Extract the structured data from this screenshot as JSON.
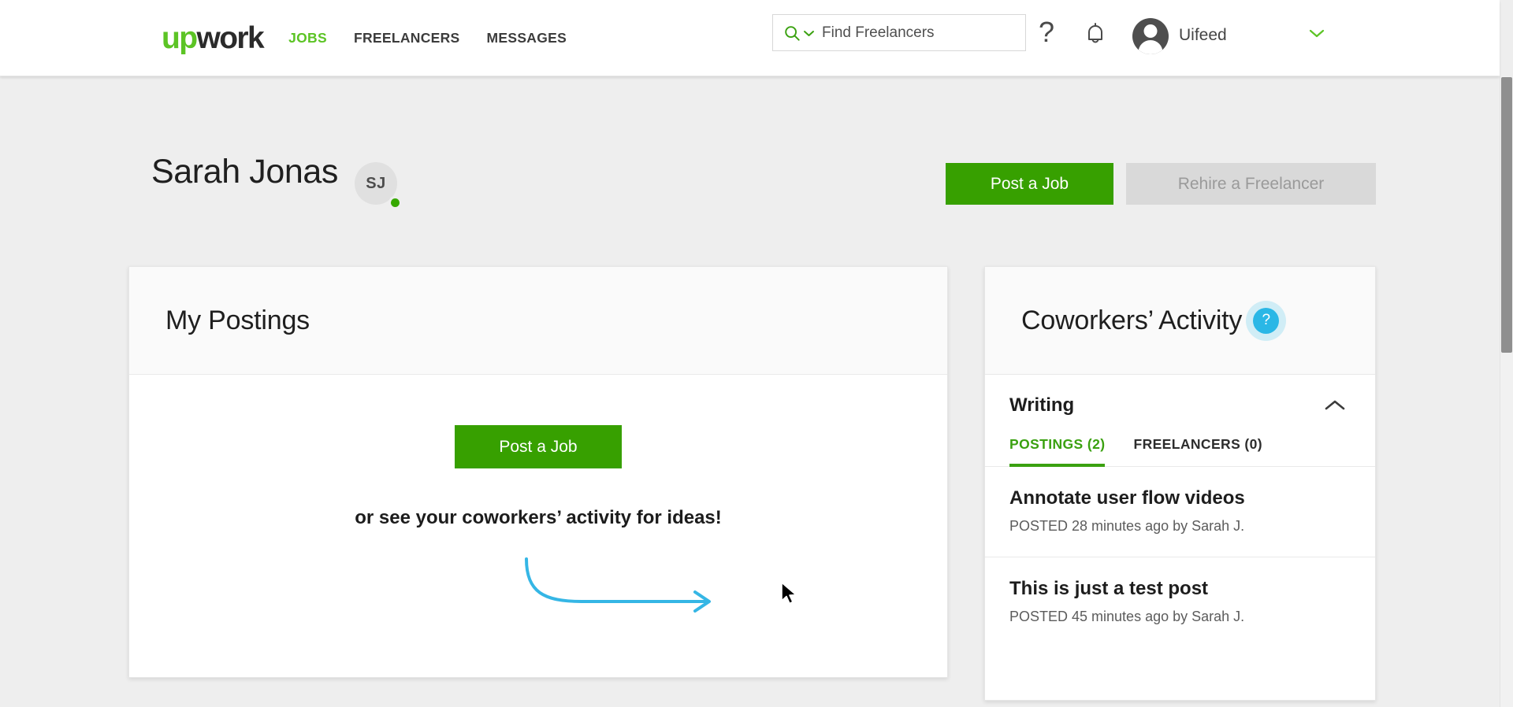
{
  "topnav": {
    "logo_up": "up",
    "logo_work": "work",
    "links": [
      {
        "label": "JOBS",
        "active": true
      },
      {
        "label": "FREELANCERS",
        "active": false
      },
      {
        "label": "MESSAGES",
        "active": false
      }
    ],
    "search": {
      "placeholder": "Find Freelancers",
      "icon": "search-icon",
      "dropdown_icon": "chevron-down-icon"
    },
    "help_icon": "question-mark-icon",
    "notifications_icon": "bell-icon",
    "user": {
      "name": "Uifeed",
      "avatar_icon": "user-avatar-icon",
      "menu_icon": "chevron-down-icon"
    }
  },
  "page_header": {
    "title": "Sarah Jonas",
    "avatar_initials": "SJ",
    "status": "online",
    "primary_button": "Post a Job",
    "secondary_button": "Rehire a Freelancer"
  },
  "postings_card": {
    "title": "My Postings",
    "empty_state": {
      "button": "Post a Job",
      "text": "or see your coworkers’ activity for ideas!",
      "arrow_icon": "curved-arrow-right-icon"
    }
  },
  "activity_card": {
    "title": "Coworkers’ Activity",
    "help_badge": "?",
    "section": {
      "name": "Writing",
      "collapse_icon": "chevron-up-icon",
      "tabs": [
        {
          "label": "POSTINGS (2)",
          "active": true
        },
        {
          "label": "FREELANCERS (0)",
          "active": false
        }
      ],
      "postings": [
        {
          "title": "Annotate user flow videos",
          "meta": "POSTED 28 minutes ago by Sarah J."
        },
        {
          "title": "This is just a test post",
          "meta": "POSTED 45 minutes ago by Sarah J."
        }
      ]
    }
  },
  "colors": {
    "brand_green": "#5cc425",
    "button_green": "#37a000",
    "tab_green": "#3aa110",
    "accent_cyan": "#2ab7e6",
    "arrow_blue": "#35b6e5",
    "online_green": "#36a800",
    "page_bg": "#eeeeee"
  }
}
